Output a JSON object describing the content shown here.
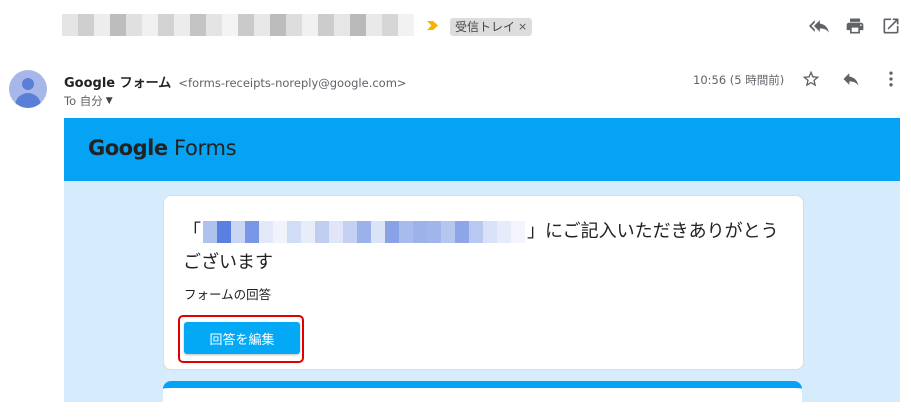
{
  "header": {
    "label_chip": "受信トレイ",
    "label_remove": "×",
    "icons": [
      "reply-all-icon",
      "print-icon",
      "open-in-new-window-icon"
    ]
  },
  "message": {
    "sender_name": "Google フォーム",
    "sender_email": "<forms-receipts-noreply@google.com>",
    "to_label": "To 自分",
    "time": "10:56 (5 時間前)",
    "icons": [
      "star-icon",
      "reply-icon",
      "more-vert-icon"
    ]
  },
  "email": {
    "logo_google": "Google",
    "logo_forms": "Forms",
    "title_open": "「",
    "title_close": "」にご記入いただきありがとうございます",
    "subtitle": "フォームの回答",
    "button_label": "回答を編集"
  },
  "colors": {
    "header_blue": "#06a3f5",
    "button_blue": "#03a9f4",
    "email_bg": "#d6ebfb",
    "highlight_red": "#e00000",
    "importance_yellow": "#f4b400"
  }
}
